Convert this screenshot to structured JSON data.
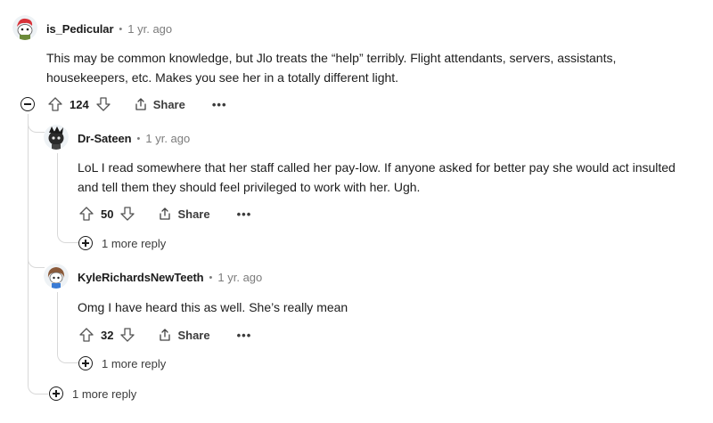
{
  "comments": [
    {
      "author": "is_Pedicular",
      "time": "1 yr. ago",
      "lines": [
        "This may be common knowledge, but Jlo treats the “help” terribly. Flight attendants, servers, assistants,",
        "housekeepers, etc. Makes you see her in a totally different light."
      ],
      "votes": "124",
      "share_label": "Share",
      "more_label": "•••",
      "more_replies": "1 more reply",
      "avatar_icon": "snoo-red-hair-avatar"
    },
    {
      "author": "Dr-Sateen",
      "time": "1 yr. ago",
      "lines": [
        "LoL I read somewhere that her staff called her pay-low. If anyone asked for better pay she would act insulted",
        "and tell them they should feel privileged to work with her. Ugh."
      ],
      "votes": "50",
      "share_label": "Share",
      "more_label": "•••",
      "more_replies": "1 more reply",
      "avatar_icon": "snoo-dark-avatar"
    },
    {
      "author": "KyleRichardsNewTeeth",
      "time": "1 yr. ago",
      "lines": [
        "Omg I have heard this as well. She’s really mean"
      ],
      "votes": "32",
      "share_label": "Share",
      "more_label": "•••",
      "more_replies": "1 more reply",
      "avatar_icon": "snoo-brown-hair-avatar"
    }
  ],
  "colors": {
    "text": "#1c1c1c",
    "muted": "#7c7c7c",
    "thread_line": "#d8d8d8"
  }
}
